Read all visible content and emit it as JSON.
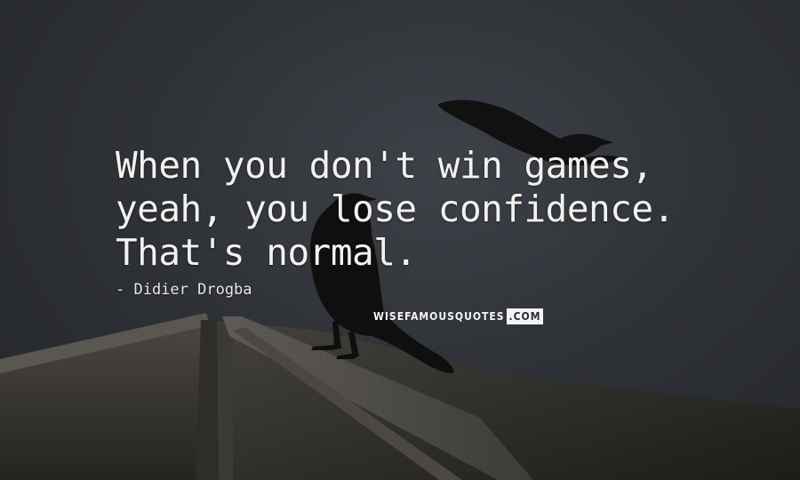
{
  "quote": {
    "lines": [
      "When you don't win games,",
      "yeah, you lose confidence.",
      "That's normal."
    ]
  },
  "author": {
    "name": "- Didier Drogba"
  },
  "watermark": {
    "main": "WISEFAMOUSQUOTES",
    "tld": ".COM"
  },
  "colors": {
    "sky": "#2f3237",
    "roof": "#3a3835",
    "text": "#f1f1ee",
    "birds": "#0f0f10"
  },
  "icons": {
    "perched_bird": "crow-silhouette",
    "flying_bird": "flying-bird-silhouette"
  }
}
